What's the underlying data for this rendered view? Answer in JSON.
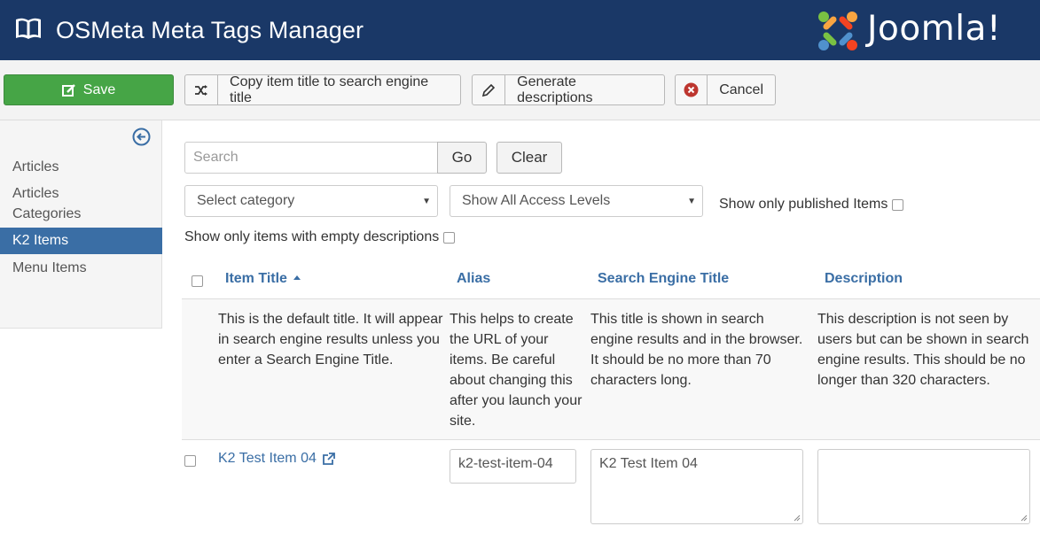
{
  "header": {
    "title": "OSMeta Meta Tags Manager",
    "brand": "Joomla!"
  },
  "toolbar": {
    "save": "Save",
    "copy_title": "Copy item title to search engine title",
    "generate": "Generate descriptions",
    "cancel": "Cancel"
  },
  "sidebar": {
    "items": [
      {
        "label": "Articles",
        "active": false
      },
      {
        "label": "Articles Categories",
        "active": false
      },
      {
        "label": "K2 Items",
        "active": true
      },
      {
        "label": "Menu Items",
        "active": false
      }
    ]
  },
  "filters": {
    "search_placeholder": "Search",
    "go": "Go",
    "clear": "Clear",
    "category": "Select category",
    "access": "Show All Access Levels",
    "published_only": "Show only published Items",
    "empty_desc_only": "Show only items with empty descriptions"
  },
  "table": {
    "columns": [
      "Item Title",
      "Alias",
      "Search Engine Title",
      "Description"
    ],
    "help": [
      "This is the default title. It will appear in search engine results unless you enter a Search Engine Title.",
      "This helps to create the URL of your items. Be careful about changing this after you launch your site.",
      "This title is shown in search engine results and in the browser. It should be no more than 70 characters long.",
      "This description is not seen by users but can be shown in search engine results. This should be no longer than 320 characters."
    ],
    "rows": [
      {
        "title": "K2 Test Item 04",
        "alias": "k2-test-item-04",
        "search_title": "K2 Test Item 04",
        "description": ""
      }
    ]
  },
  "colors": {
    "header_bg": "#1a3867",
    "save_green": "#46a546",
    "link_blue": "#3a6ea5",
    "cancel_red": "#bd362f"
  }
}
